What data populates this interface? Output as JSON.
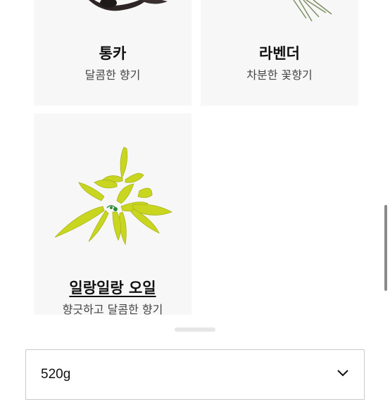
{
  "cards": [
    {
      "title": "통카",
      "subtitle": "달콤한 향기"
    },
    {
      "title": "라벤더",
      "subtitle": "차분한 꽃향기"
    },
    {
      "title": "일랑일랑 오일",
      "subtitle": "향긋하고 달콤한 향기"
    }
  ],
  "select": {
    "value": "520g"
  },
  "colors": {
    "card_bg": "#f7f7f7",
    "flower_yellow": "#c9d620",
    "flower_center": "#2f8a3a"
  }
}
